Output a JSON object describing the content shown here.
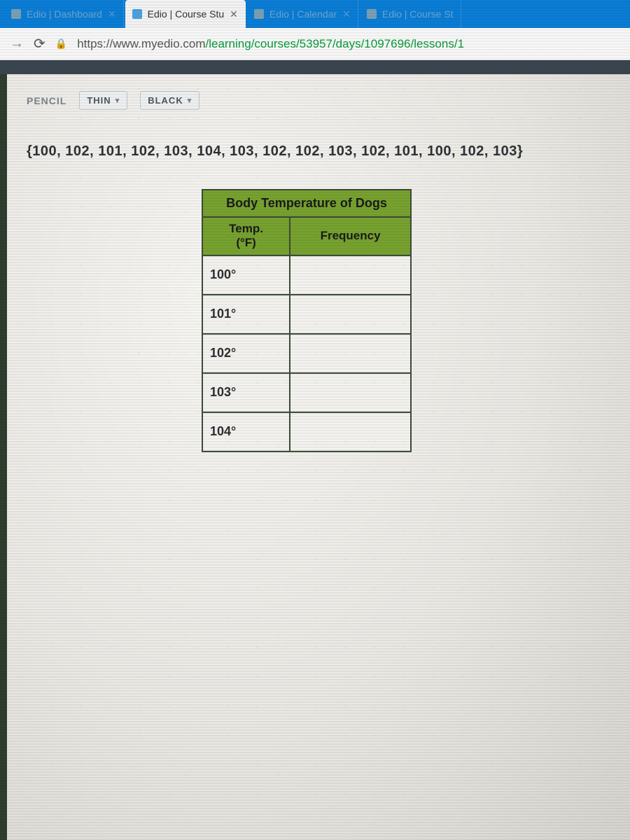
{
  "tabs": [
    {
      "title": "Edio | Dashboard",
      "active": false,
      "closable": true
    },
    {
      "title": "Edio | Course Stu",
      "active": true,
      "closable": true
    },
    {
      "title": "Edio | Calendar",
      "active": false,
      "closable": true
    },
    {
      "title": "Edio | Course St",
      "active": false,
      "closable": false
    }
  ],
  "address": {
    "host": "https://www.myedio.com",
    "path": "/learning/courses/53957/days/1097696/lessons/1"
  },
  "toolbar": {
    "tool": "PENCIL",
    "thickness": "THIN",
    "color": "BLACK"
  },
  "dataset_text": "{100, 102, 101, 102, 103, 104, 103, 102, 102, 103, 102, 101, 100, 102, 103}",
  "table": {
    "title": "Body Temperature of Dogs",
    "col1": "Temp. (°F)",
    "col2": "Frequency",
    "rows": [
      {
        "temp": "100°",
        "freq": ""
      },
      {
        "temp": "101°",
        "freq": ""
      },
      {
        "temp": "102°",
        "freq": ""
      },
      {
        "temp": "103°",
        "freq": ""
      },
      {
        "temp": "104°",
        "freq": ""
      }
    ]
  },
  "chart_data": {
    "type": "table",
    "title": "Body Temperature of Dogs",
    "columns": [
      "Temp. (°F)",
      "Frequency"
    ],
    "rows": [
      [
        "100°",
        null
      ],
      [
        "101°",
        null
      ],
      [
        "102°",
        null
      ],
      [
        "103°",
        null
      ],
      [
        "104°",
        null
      ]
    ],
    "raw_dataset": [
      100,
      102,
      101,
      102,
      103,
      104,
      103,
      102,
      102,
      103,
      102,
      101,
      100,
      102,
      103
    ]
  }
}
